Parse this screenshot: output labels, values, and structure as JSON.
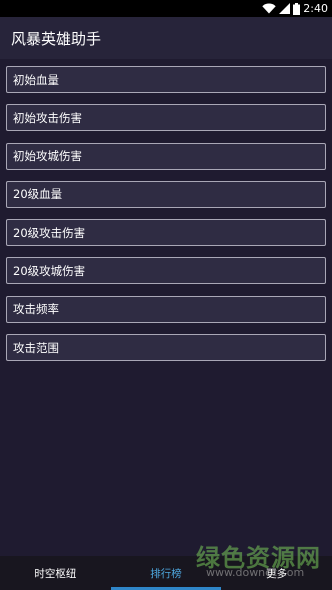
{
  "status_bar": {
    "time": "2:40",
    "icons": [
      "wifi-icon",
      "signal-icon",
      "battery-icon"
    ]
  },
  "app_bar": {
    "title": "风暴英雄助手"
  },
  "menu_items": [
    {
      "label": "初始血量"
    },
    {
      "label": "初始攻击伤害"
    },
    {
      "label": "初始攻城伤害"
    },
    {
      "label": "20级血量"
    },
    {
      "label": "20级攻击伤害"
    },
    {
      "label": "20级攻城伤害"
    },
    {
      "label": "攻击频率"
    },
    {
      "label": "攻击范围"
    }
  ],
  "bottom_nav": {
    "tabs": [
      {
        "label": "时空枢纽",
        "active": false
      },
      {
        "label": "排行榜",
        "active": true
      },
      {
        "label": "更多",
        "active": false
      }
    ]
  },
  "watermark": {
    "title": "绿色资源网",
    "url": "www.downcc.com"
  },
  "colors": {
    "background": "#1f1b30",
    "app_bar": "#27243a",
    "item_border": "#a9a7b6",
    "active_tab": "#4ea8e0",
    "status_bar": "#000000"
  }
}
